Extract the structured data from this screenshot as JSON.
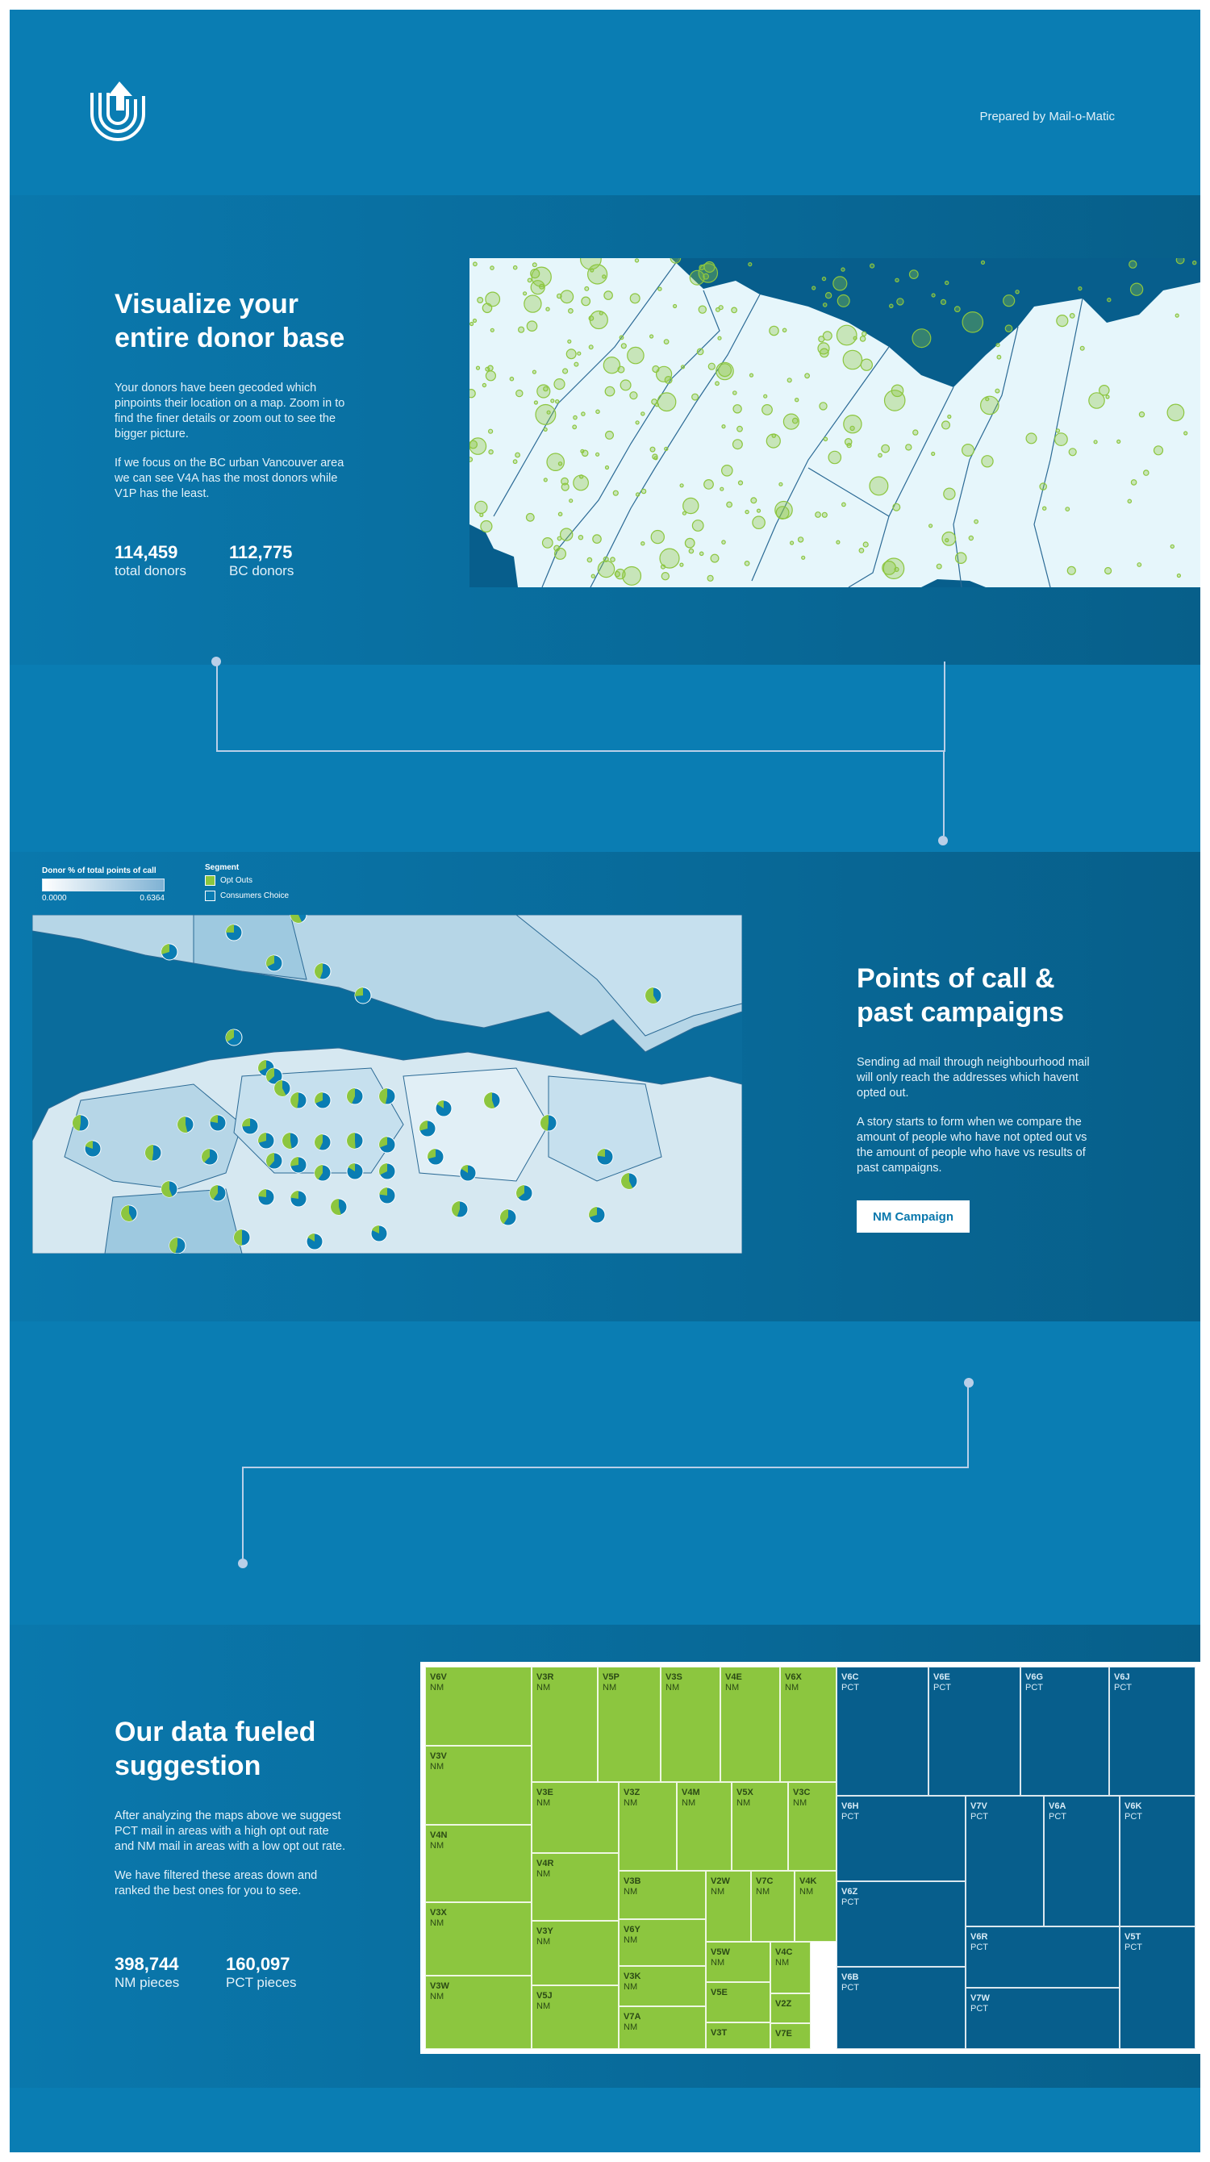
{
  "header": {
    "prepared_by": "Prepared by Mail-o-Matic"
  },
  "section1": {
    "title_line1": "Visualize your",
    "title_line2": "entire donor base",
    "para1": "Your donors have been gecoded which pinpoints their location on a map. Zoom in to find the finer details or zoom out to see the bigger picture.",
    "para2": "If we focus on the BC urban Vancouver area we can see V4A has the most donors while V1P has the least.",
    "stat1_value": "114,459",
    "stat1_label": "total donors",
    "stat2_value": "112,775",
    "stat2_label": "BC donors"
  },
  "section2": {
    "title_line1": "Points of call &",
    "title_line2": "past campaigns",
    "para1": "Sending ad mail through neighbourhood mail will only reach the addresses which havent opted out.",
    "para2": "A story starts to form when we compare the amount of people who have not opted out vs the amount of people who have vs results of past campaigns.",
    "button_label": "NM Campaign",
    "legend": {
      "gradient_title": "Donor % of total points of call",
      "gradient_min": "0.0000",
      "gradient_max": "0.6364",
      "segment_title": "Segment",
      "segment_items": [
        "Opt Outs",
        "Consumers Choice"
      ]
    }
  },
  "section3": {
    "title_line1": "Our data fueled",
    "title_line2": "suggestion",
    "para1": "After analyzing the maps above we suggest PCT mail in areas with a high opt out rate and NM mail in areas with a low opt out rate.",
    "para2": "We have filtered these areas down and ranked the best ones for you to see.",
    "stat1_value": "398,744",
    "stat1_label": "NM pieces",
    "stat2_value": "160,097",
    "stat2_label": "PCT pieces"
  },
  "treemap": {
    "nm": [
      {
        "code": "V6V",
        "type": "NM"
      },
      {
        "code": "V3V",
        "type": "NM"
      },
      {
        "code": "V4N",
        "type": "NM"
      },
      {
        "code": "V3X",
        "type": "NM"
      },
      {
        "code": "V3W",
        "type": "NM"
      },
      {
        "code": "V3R",
        "type": "NM"
      },
      {
        "code": "V5P",
        "type": "NM"
      },
      {
        "code": "V3S",
        "type": "NM"
      },
      {
        "code": "V4E",
        "type": "NM"
      },
      {
        "code": "V6X",
        "type": "NM"
      },
      {
        "code": "V3E",
        "type": "NM"
      },
      {
        "code": "V3Z",
        "type": "NM"
      },
      {
        "code": "V4M",
        "type": "NM"
      },
      {
        "code": "V5X",
        "type": "NM"
      },
      {
        "code": "V3C",
        "type": "NM"
      },
      {
        "code": "V4R",
        "type": "NM"
      },
      {
        "code": "V3B",
        "type": "NM"
      },
      {
        "code": "V2W",
        "type": "NM"
      },
      {
        "code": "V7C",
        "type": "NM"
      },
      {
        "code": "V4K",
        "type": "NM"
      },
      {
        "code": "V3Y",
        "type": "NM"
      },
      {
        "code": "V6Y",
        "type": "NM"
      },
      {
        "code": "V5W",
        "type": "NM"
      },
      {
        "code": "V4C",
        "type": "NM"
      },
      {
        "code": "V5J",
        "type": "NM"
      },
      {
        "code": "V3K",
        "type": "NM"
      },
      {
        "code": "V5E",
        "type": ""
      },
      {
        "code": "V2Z",
        "type": ""
      },
      {
        "code": "V7A",
        "type": "NM"
      },
      {
        "code": "V3T",
        "type": ""
      },
      {
        "code": "V7E",
        "type": ""
      }
    ],
    "pct": [
      {
        "code": "V6C",
        "type": "PCT"
      },
      {
        "code": "V6E",
        "type": "PCT"
      },
      {
        "code": "V6G",
        "type": "PCT"
      },
      {
        "code": "V6J",
        "type": "PCT"
      },
      {
        "code": "V6H",
        "type": "PCT"
      },
      {
        "code": "V7V",
        "type": "PCT"
      },
      {
        "code": "V6A",
        "type": "PCT"
      },
      {
        "code": "V6K",
        "type": "PCT"
      },
      {
        "code": "V6Z",
        "type": "PCT"
      },
      {
        "code": "V6R",
        "type": "PCT"
      },
      {
        "code": "V5T",
        "type": "PCT"
      },
      {
        "code": "V6B",
        "type": "PCT"
      },
      {
        "code": "V7W",
        "type": "PCT"
      }
    ]
  },
  "colors": {
    "background": "#0a7db3",
    "nm_green": "#8cc63f",
    "pct_blue": "#075e8c",
    "map_land": "#e6f6fb",
    "connector": "#b9cfe8"
  }
}
